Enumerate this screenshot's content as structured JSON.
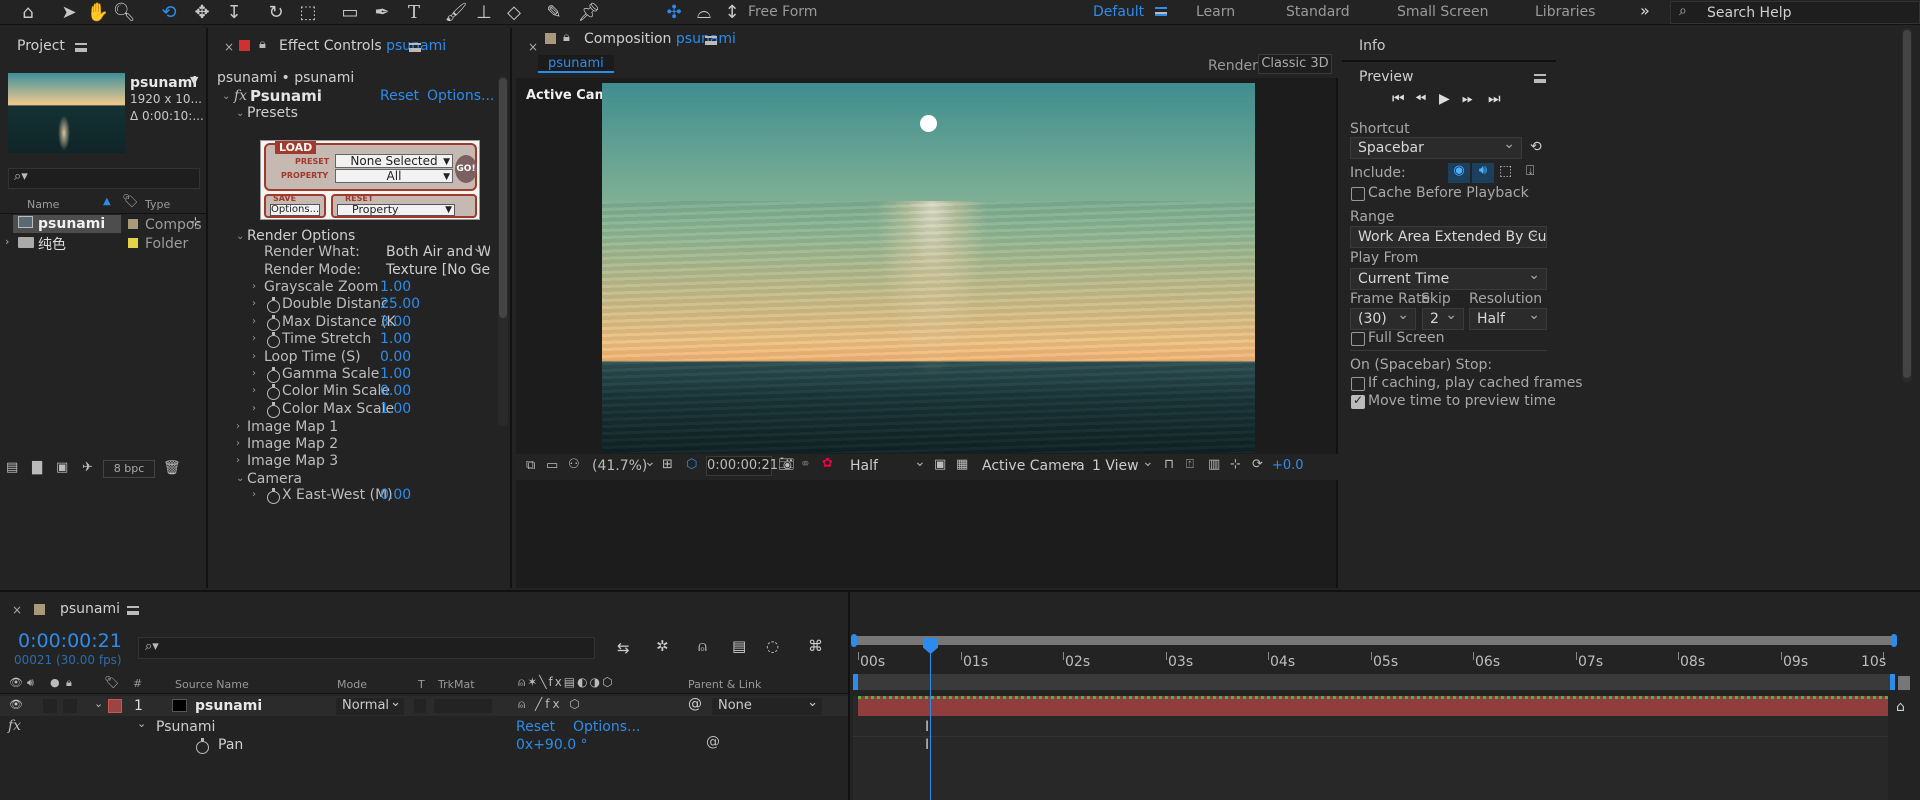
{
  "toolbar": {
    "workspaces": [
      "Default",
      "Learn",
      "Standard",
      "Small Screen",
      "Libraries"
    ],
    "free_form": "Free Form",
    "search_placeholder": "Search Help",
    "more": "»"
  },
  "project": {
    "title": "Project",
    "item_name": "psunami",
    "item_size": "1920 x 10...",
    "item_duration": "Δ 0:00:10:...",
    "search_placeholder": "",
    "col_name": "Name",
    "col_type": "Type",
    "rows": [
      {
        "name": "psunami",
        "type": "Compos",
        "label_color": "#a8997a"
      },
      {
        "name": "纯色",
        "type": "Folder",
        "label_color": "#e5d24a"
      }
    ],
    "bpc": "8 bpc"
  },
  "effect": {
    "title": "Effect Controls",
    "comp": "psunami",
    "breadcrumb": "psunami • psunami",
    "effect_name": "Psunami",
    "reset": "Reset",
    "options": "Options...",
    "presets": "Presets",
    "preset_box": {
      "load": "LOAD",
      "preset_lbl": "PRESET",
      "property_lbl": "PROPERTY",
      "preset_val": "None Selected",
      "property_val": "All",
      "go": "GO!",
      "save": "SAVE",
      "options_btn": "Options...",
      "reset": "RESET",
      "reset_val": "Property"
    },
    "render_options": "Render Options",
    "render_what_lbl": "Render What:",
    "render_what": "Both Air and Wat",
    "render_mode_lbl": "Render Mode:",
    "render_mode": "Texture [No Geor",
    "params": [
      {
        "name": "Grayscale Zoom",
        "value": "1.00",
        "stopwatch": false
      },
      {
        "name": "Double Distanc",
        "value": "25.00",
        "stopwatch": true
      },
      {
        "name": "Max Distance (K",
        "value": "3.00",
        "stopwatch": true
      },
      {
        "name": "Time Stretch",
        "value": "1.00",
        "stopwatch": true
      },
      {
        "name": "Loop Time (S)",
        "value": "0.00",
        "stopwatch": false
      },
      {
        "name": "Gamma Scale",
        "value": "1.00",
        "stopwatch": true
      },
      {
        "name": "Color Min Scale",
        "value": "0.00",
        "stopwatch": true
      },
      {
        "name": "Color Max Scale",
        "value": "1.00",
        "stopwatch": true
      }
    ],
    "groups": [
      "Image Map 1",
      "Image Map 2",
      "Image Map 3",
      "Camera"
    ],
    "camera_param": {
      "name": "X East-West (M)",
      "value": "0.00"
    }
  },
  "composition": {
    "title": "Composition",
    "comp": "psunami",
    "tab": "psunami",
    "renderer_label": "Renderer:",
    "renderer": "Classic 3D",
    "active_camera": "Active Camera",
    "zoom": "(41.7%)",
    "timecode": "0:00:00:21",
    "resolution": "Half",
    "camera": "Active Camera",
    "views": "1 View",
    "exposure": "+0.0"
  },
  "info": {
    "title": "Info"
  },
  "preview": {
    "title": "Preview",
    "shortcut_label": "Shortcut",
    "shortcut": "Spacebar",
    "include_label": "Include:",
    "cache_before": "Cache Before Playback",
    "range_label": "Range",
    "range": "Work Area Extended By Current...",
    "play_from_label": "Play From",
    "play_from": "Current Time",
    "frame_rate_label": "Frame Rate",
    "skip_label": "Skip",
    "resolution_label": "Resolution",
    "frame_rate": "(30)",
    "skip": "2",
    "resolution": "Half",
    "full_screen": "Full Screen",
    "on_stop_label": "On (Spacebar) Stop:",
    "if_caching": "If caching, play cached frames",
    "move_time": "Move time to preview time"
  },
  "timeline": {
    "comp": "psunami",
    "timecode": "0:00:00:21",
    "frames": "00021 (30.00 fps)",
    "search_placeholder": "",
    "col_source": "Source Name",
    "col_mode": "Mode",
    "col_t": "T",
    "col_trkmat": "TrkMat",
    "col_parent": "Parent & Link",
    "layer_num": "1",
    "layer_name": "psunami",
    "mode": "Normal",
    "parent": "None",
    "effect_row": "Psunami",
    "reset": "Reset",
    "options": "Options...",
    "pan_label": "Pan",
    "pan_value": "0x+90.0 °",
    "ruler": [
      "00s",
      "01s",
      "02s",
      "03s",
      "04s",
      "05s",
      "06s",
      "07s",
      "08s",
      "09s",
      "10s"
    ],
    "layer_color": "#9e4343"
  }
}
